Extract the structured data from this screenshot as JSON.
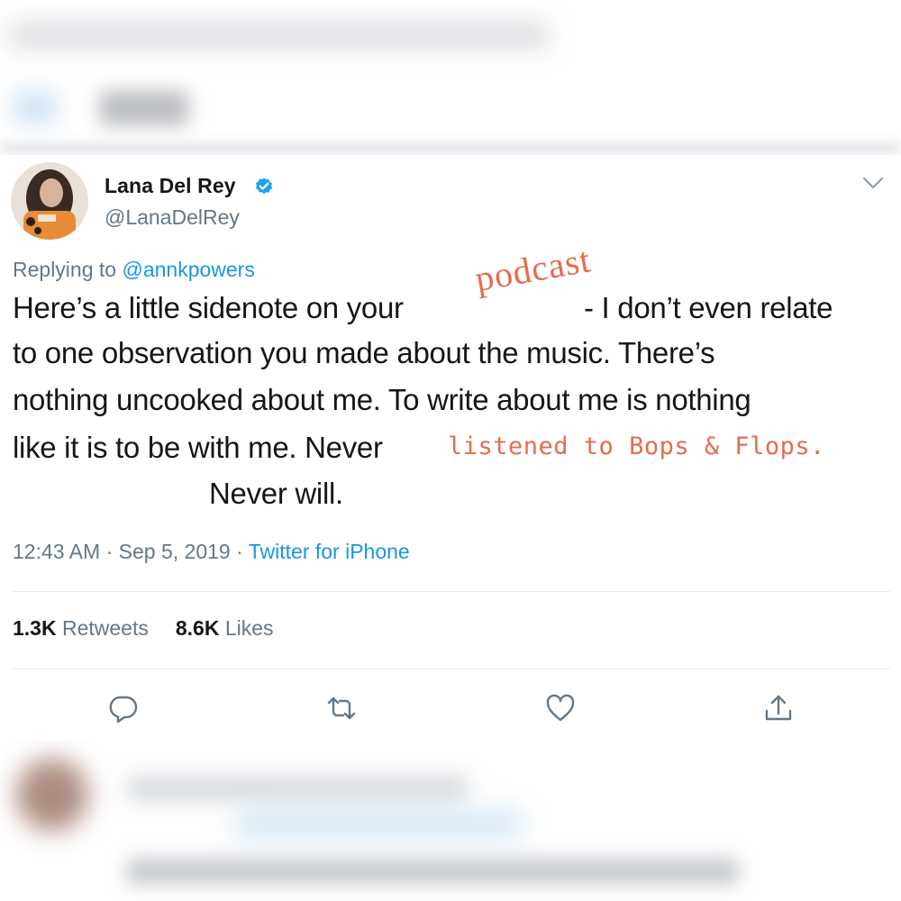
{
  "tweet": {
    "display_name": "Lana Del Rey",
    "handle": "@LanaDelRey",
    "reply_prefix": "Replying to",
    "reply_to": "@annkpowers",
    "text_lines": [
      "Here’s a little sidenote on your",
      "- I don’t even relate",
      "to one observation you made about the music. There’s",
      "nothing uncooked about me. To write about me is nothing",
      "like it is to be with me. Never",
      "Never will."
    ],
    "overlay_texts": [
      "podcast",
      "listened to Bops & Flops."
    ],
    "time": "12:43 AM",
    "date": "Sep 5, 2019",
    "separator": "·",
    "source": "Twitter for iPhone",
    "retweets_count": "1.3K",
    "retweets_label": "Retweets",
    "likes_count": "8.6K",
    "likes_label": "Likes"
  },
  "icons": {
    "verified": "verified-badge-icon",
    "more": "chevron-down-icon",
    "reply": "reply-icon",
    "retweet": "retweet-icon",
    "like": "heart-icon",
    "share": "share-icon"
  },
  "colors": {
    "link": "#1b95e0",
    "secondary_text": "#657786",
    "primary_text": "#14171a",
    "overlay_orange": "#e66c4c",
    "divider": "#e6ecf0"
  }
}
